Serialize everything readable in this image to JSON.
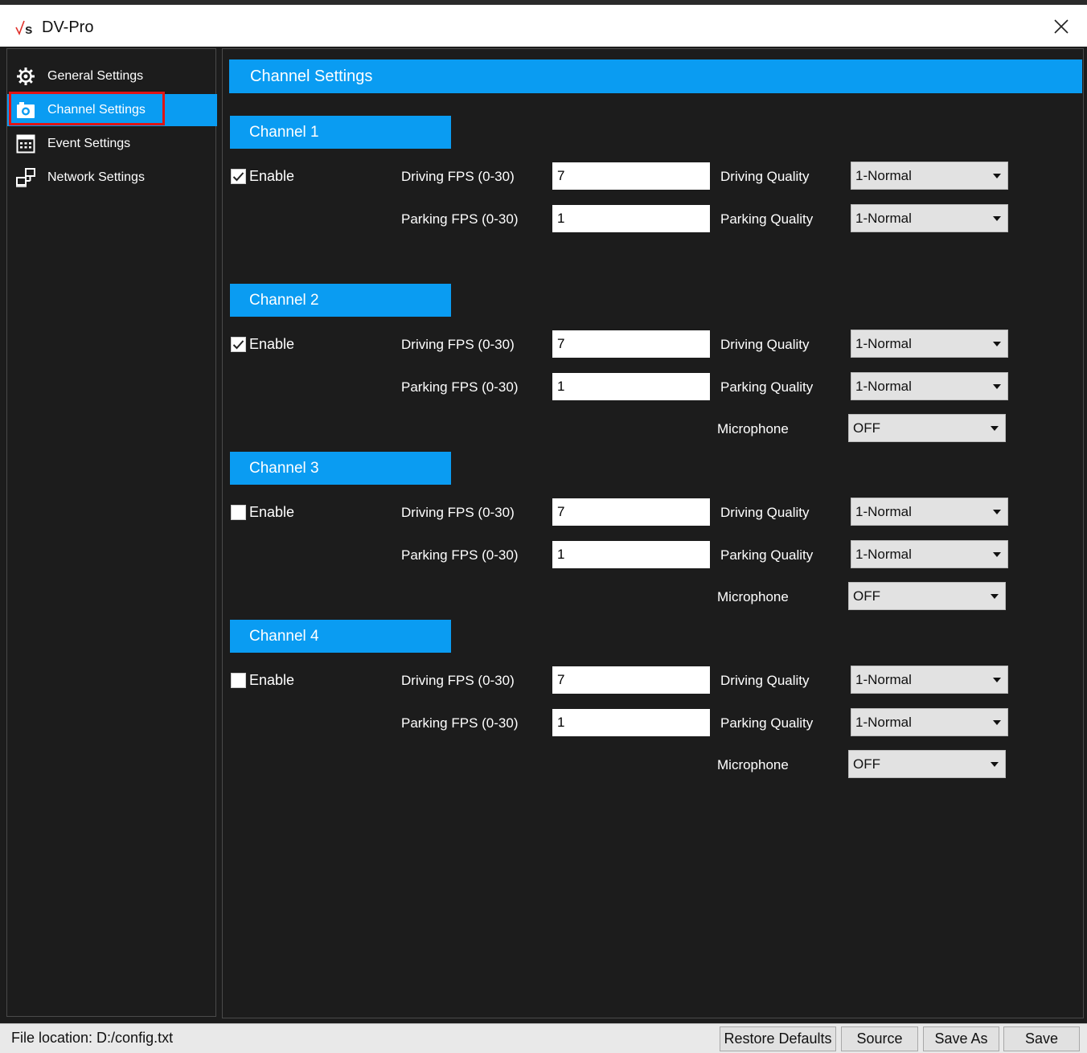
{
  "window": {
    "title": "DV-Pro"
  },
  "sidebar": {
    "items": [
      {
        "label": "General Settings"
      },
      {
        "label": "Channel Settings"
      },
      {
        "label": "Event Settings"
      },
      {
        "label": "Network Settings"
      }
    ]
  },
  "main": {
    "header": "Channel Settings",
    "channels": [
      {
        "title": "Channel 1",
        "enable_label": "Enable",
        "enabled": true,
        "driving_fps_label": "Driving  FPS (0-30)",
        "driving_fps": "7",
        "parking_fps_label": "Parking FPS (0-30)",
        "parking_fps": "1",
        "driving_quality_label": "Driving Quality",
        "driving_quality": "1-Normal",
        "parking_quality_label": "Parking Quality",
        "parking_quality": "1-Normal"
      },
      {
        "title": "Channel 2",
        "enable_label": "Enable",
        "enabled": true,
        "driving_fps_label": "Driving  FPS (0-30)",
        "driving_fps": "7",
        "parking_fps_label": "Parking FPS (0-30)",
        "parking_fps": "1",
        "driving_quality_label": "Driving Quality",
        "driving_quality": "1-Normal",
        "parking_quality_label": "Parking Quality",
        "parking_quality": "1-Normal",
        "microphone_label": "Microphone",
        "microphone": "OFF"
      },
      {
        "title": "Channel 3",
        "enable_label": "Enable",
        "enabled": false,
        "driving_fps_label": "Driving  FPS (0-30)",
        "driving_fps": "7",
        "parking_fps_label": "Parking FPS (0-30)",
        "parking_fps": "1",
        "driving_quality_label": "Driving Quality",
        "driving_quality": "1-Normal",
        "parking_quality_label": "Parking Quality",
        "parking_quality": "1-Normal",
        "microphone_label": "Microphone",
        "microphone": "OFF"
      },
      {
        "title": "Channel 4",
        "enable_label": "Enable",
        "enabled": false,
        "driving_fps_label": "Driving  FPS (0-30)",
        "driving_fps": "7",
        "parking_fps_label": "Parking FPS (0-30)",
        "parking_fps": "1",
        "driving_quality_label": "Driving Quality",
        "driving_quality": "1-Normal",
        "parking_quality_label": "Parking Quality",
        "parking_quality": "1-Normal",
        "microphone_label": "Microphone",
        "microphone": "OFF"
      }
    ]
  },
  "statusbar": {
    "file_location": "File location: D:/config.txt",
    "buttons": {
      "restore_defaults": "Restore Defaults",
      "source": "Source",
      "save_as": "Save As",
      "save": "Save"
    }
  },
  "colors": {
    "accent": "#0a9cf2",
    "background": "#1c1c1c",
    "highlight_border": "#e01414"
  }
}
